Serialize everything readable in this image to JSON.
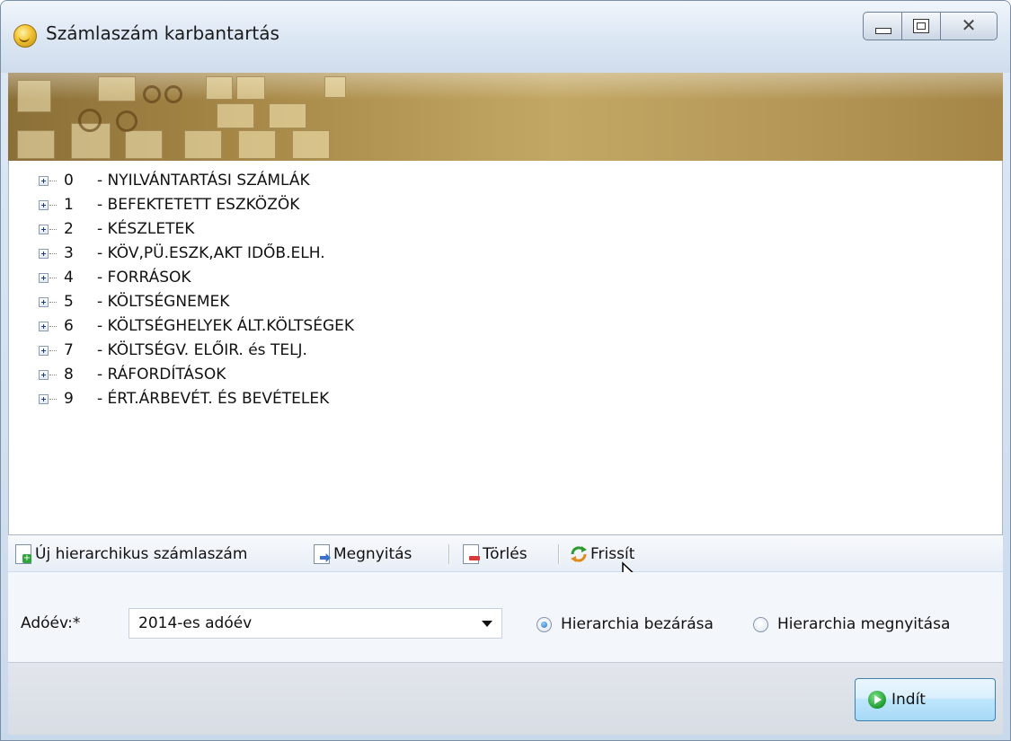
{
  "window": {
    "title": "Számlaszám karbantartás"
  },
  "tree": {
    "items": [
      {
        "code": "0",
        "label": "- NYILVÁNTARTÁSI SZÁMLÁK"
      },
      {
        "code": "1",
        "label": "- BEFEKTETETT ESZKÖZÖK"
      },
      {
        "code": "2",
        "label": "- KÉSZLETEK"
      },
      {
        "code": "3",
        "label": "- KÖV,PÜ.ESZK,AKT IDŐB.ELH."
      },
      {
        "code": "4",
        "label": "- FORRÁSOK"
      },
      {
        "code": "5",
        "label": "- KÖLTSÉGNEMEK"
      },
      {
        "code": "6",
        "label": "- KÖLTSÉGHELYEK ÁLT.KÖLTSÉGEK"
      },
      {
        "code": "7",
        "label": "- KÖLTSÉGV. ELŐIR. és TELJ."
      },
      {
        "code": "8",
        "label": "- RÁFORDÍTÁSOK"
      },
      {
        "code": "9",
        "label": "- ÉRT.ÁRBEVÉT. ÉS BEVÉTELEK"
      }
    ]
  },
  "toolbar": {
    "new_label": "Új hierarchikus számlaszám",
    "open_label": "Megnyitás",
    "delete_label": "Törlés",
    "refresh_label": "Frissít"
  },
  "filters": {
    "year_label": "Adóév:*",
    "year_value": "2014-es adóév",
    "radio_close_label": "Hierarchia bezárása",
    "radio_open_label": "Hierarchia megnyitása",
    "selected": "close"
  },
  "footer": {
    "start_label": "Indít"
  }
}
